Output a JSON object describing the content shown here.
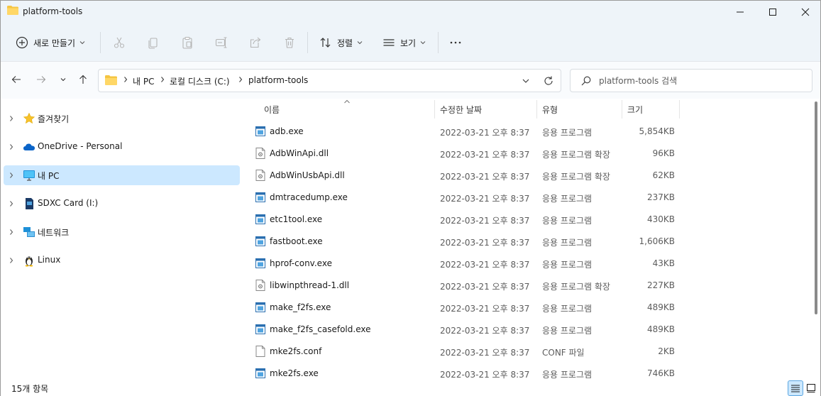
{
  "window": {
    "title": "platform-tools",
    "controls": {
      "minimize_icon": "minimize-icon",
      "maximize_icon": "maximize-icon",
      "close_icon": "close-icon"
    }
  },
  "toolbar": {
    "new_label": "새로 만들기",
    "sort_label": "정렬",
    "view_label": "보기",
    "more_icon": "more-icon",
    "icons": [
      "cut-icon",
      "copy-icon",
      "paste-icon",
      "rename-icon",
      "share-icon",
      "delete-icon"
    ]
  },
  "address": {
    "crumbs": [
      "내 PC",
      "로컬 디스크 (C:)",
      "platform-tools"
    ]
  },
  "search": {
    "placeholder": "platform-tools 검색"
  },
  "nav": {
    "items": [
      {
        "label": "즐겨찾기",
        "icon": "star-icon",
        "selected": false
      },
      {
        "label": "OneDrive - Personal",
        "icon": "cloud-icon",
        "selected": false
      },
      {
        "label": "내 PC",
        "icon": "monitor-icon",
        "selected": true
      },
      {
        "label": "SDXC Card (I:)",
        "icon": "sd-card-icon",
        "selected": false
      },
      {
        "label": "네트워크",
        "icon": "network-icon",
        "selected": false
      },
      {
        "label": "Linux",
        "icon": "linux-penguin-icon",
        "selected": false
      }
    ]
  },
  "columns": {
    "name": "이름",
    "date": "수정한 날짜",
    "type": "유형",
    "size": "크기"
  },
  "files": [
    {
      "name": "adb.exe",
      "date": "2022-03-21 오후 8:37",
      "type": "응용 프로그램",
      "size": "5,854KB",
      "icon": "exe-icon"
    },
    {
      "name": "AdbWinApi.dll",
      "date": "2022-03-21 오후 8:37",
      "type": "응용 프로그램 확장",
      "size": "96KB",
      "icon": "dll-icon"
    },
    {
      "name": "AdbWinUsbApi.dll",
      "date": "2022-03-21 오후 8:37",
      "type": "응용 프로그램 확장",
      "size": "62KB",
      "icon": "dll-icon"
    },
    {
      "name": "dmtracedump.exe",
      "date": "2022-03-21 오후 8:37",
      "type": "응용 프로그램",
      "size": "237KB",
      "icon": "exe-icon"
    },
    {
      "name": "etc1tool.exe",
      "date": "2022-03-21 오후 8:37",
      "type": "응용 프로그램",
      "size": "430KB",
      "icon": "exe-icon"
    },
    {
      "name": "fastboot.exe",
      "date": "2022-03-21 오후 8:37",
      "type": "응용 프로그램",
      "size": "1,606KB",
      "icon": "exe-icon"
    },
    {
      "name": "hprof-conv.exe",
      "date": "2022-03-21 오후 8:37",
      "type": "응용 프로그램",
      "size": "43KB",
      "icon": "exe-icon"
    },
    {
      "name": "libwinpthread-1.dll",
      "date": "2022-03-21 오후 8:37",
      "type": "응용 프로그램 확장",
      "size": "227KB",
      "icon": "dll-icon"
    },
    {
      "name": "make_f2fs.exe",
      "date": "2022-03-21 오후 8:37",
      "type": "응용 프로그램",
      "size": "489KB",
      "icon": "exe-icon"
    },
    {
      "name": "make_f2fs_casefold.exe",
      "date": "2022-03-21 오후 8:37",
      "type": "응용 프로그램",
      "size": "489KB",
      "icon": "exe-icon"
    },
    {
      "name": "mke2fs.conf",
      "date": "2022-03-21 오후 8:37",
      "type": "CONF 파일",
      "size": "2KB",
      "icon": "file-icon"
    },
    {
      "name": "mke2fs.exe",
      "date": "2022-03-21 오후 8:37",
      "type": "응용 프로그램",
      "size": "746KB",
      "icon": "exe-icon"
    }
  ],
  "status": {
    "count_text": "15개 항목"
  },
  "colors": {
    "selection": "#cce8ff",
    "chrome": "#eef4f9",
    "accent": "#0067c0"
  }
}
